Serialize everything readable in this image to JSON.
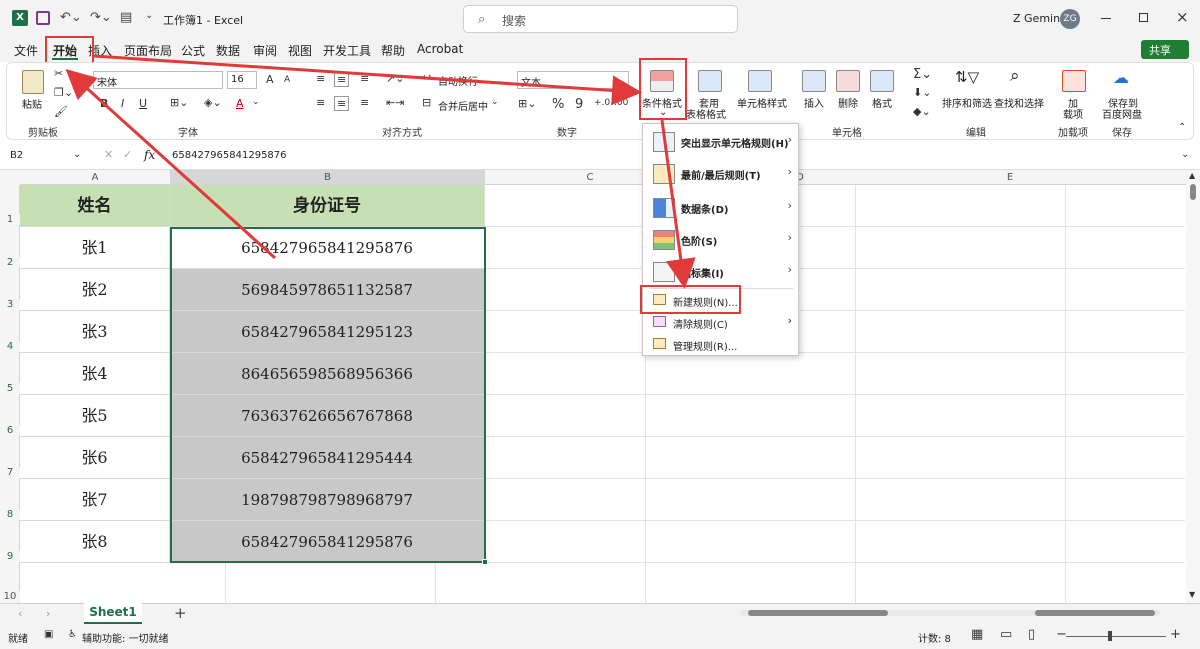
{
  "titlebar": {
    "app_badge": "X",
    "title": "工作簿1 - Excel",
    "search_placeholder": "搜索",
    "user_name": "Z Gemini",
    "user_initials": "ZG"
  },
  "menubar": {
    "tabs": [
      "文件",
      "开始",
      "插入",
      "页面布局",
      "公式",
      "数据",
      "审阅",
      "视图",
      "开发工具",
      "帮助",
      "Acrobat"
    ],
    "share_label": "共享"
  },
  "ribbon": {
    "clipboard": {
      "paste": "粘贴",
      "group": "剪贴板"
    },
    "font": {
      "name": "宋体",
      "size": "16",
      "bold": "B",
      "italic": "I",
      "underline": "U",
      "grow": "A",
      "shrink": "A",
      "font_color": "A",
      "group": "字体"
    },
    "alignment": {
      "wrap": "自动换行",
      "merge": "合并后居中",
      "group": "对齐方式"
    },
    "number": {
      "format": "文本",
      "percent": "%",
      "comma": "9",
      "group": "数字"
    },
    "styles": {
      "conditional": "条件格式",
      "table_line1": "套用",
      "table_line2": "表格格式",
      "cell_styles": "单元格样式"
    },
    "cells": {
      "insert": "插入",
      "delete": "删除",
      "format": "格式",
      "group": "单元格"
    },
    "editing": {
      "sort": "排序和筛选",
      "find": "查找和选择",
      "group": "编辑"
    },
    "addins": {
      "label_line1": "加",
      "label_line2": "载项",
      "group": "加载项"
    },
    "save": {
      "label_line1": "保存到",
      "label_line2": "百度网盘",
      "group": "保存"
    }
  },
  "formula_bar": {
    "name_box": "B2",
    "fx": "fx",
    "value": "658427965841295876"
  },
  "grid": {
    "columns": [
      "A",
      "B",
      "C",
      "D",
      "E"
    ],
    "headers": [
      "姓名",
      "身份证号"
    ],
    "rows": [
      {
        "num": "2",
        "name": "张1",
        "id": "658427965841295876"
      },
      {
        "num": "3",
        "name": "张2",
        "id": "569845978651132587"
      },
      {
        "num": "4",
        "name": "张3",
        "id": "658427965841295123"
      },
      {
        "num": "5",
        "name": "张4",
        "id": "864656598568956366"
      },
      {
        "num": "6",
        "name": "张5",
        "id": "763637626656767868"
      },
      {
        "num": "7",
        "name": "张6",
        "id": "658427965841295444"
      },
      {
        "num": "8",
        "name": "张7",
        "id": "198798798798968797"
      },
      {
        "num": "9",
        "name": "张8",
        "id": "658427965841295876"
      }
    ],
    "header_row_num": "1",
    "extra_row_num": "10",
    "header_fill": "#c6e0b4",
    "selection_fill": "#c8c8c8"
  },
  "dropdown": {
    "items": [
      {
        "label": "突出显示单元格规则(H)",
        "icon": "highlight-rules-icon"
      },
      {
        "label": "最前/最后规则(T)",
        "icon": "top-bottom-icon"
      },
      {
        "label": "数据条(D)",
        "icon": "databar-icon"
      },
      {
        "label": "色阶(S)",
        "icon": "colorscale-icon"
      },
      {
        "label": "图标集(I)",
        "icon": "iconset-icon"
      }
    ],
    "new_rule": "新建规则(N)...",
    "clear_rules": "清除规则(C)",
    "manage_rules": "管理规则(R)..."
  },
  "sheets": {
    "active": "Sheet1",
    "add": "+"
  },
  "status": {
    "ready": "就绪",
    "accessibility": "辅助功能: 一切就绪",
    "count": "计数: 8"
  },
  "colors": {
    "excel_green": "#1e7145",
    "accent_red": "#e03a3a",
    "share_green": "#1e7e34"
  }
}
